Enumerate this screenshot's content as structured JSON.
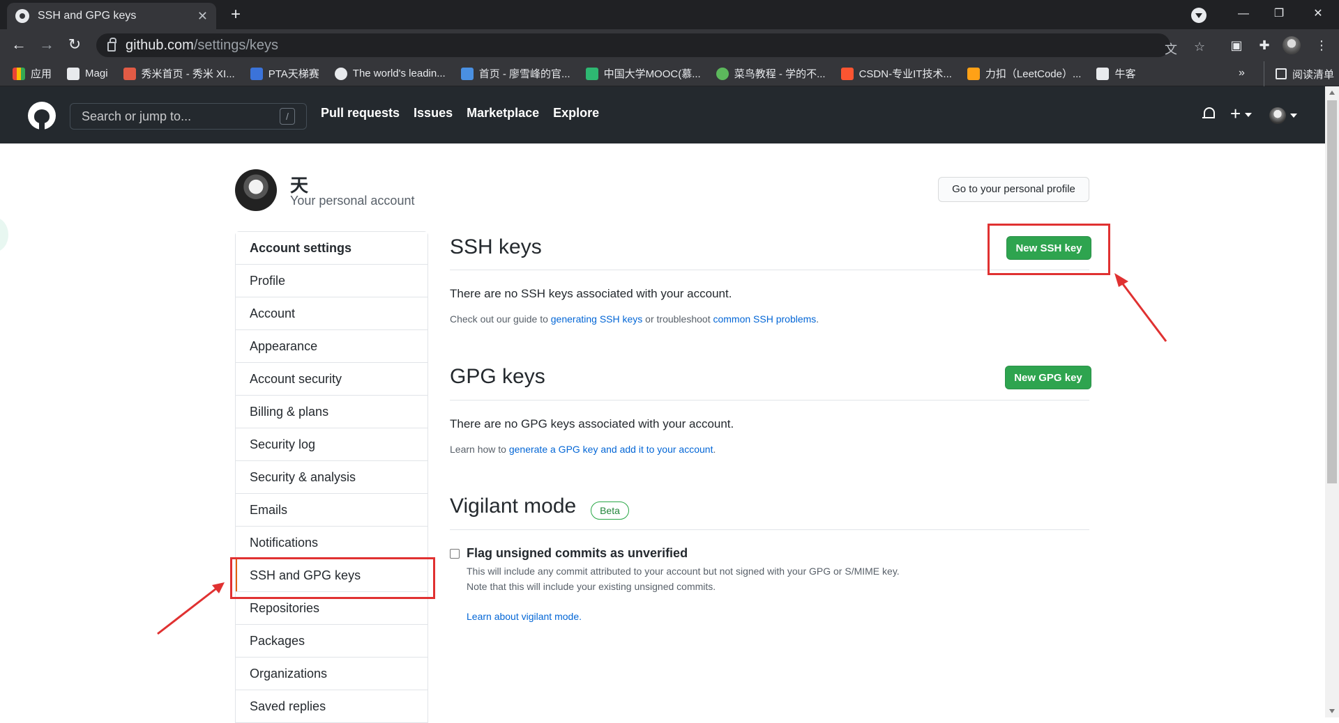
{
  "browser": {
    "tab_title": "SSH and GPG keys",
    "tab_close": "✕",
    "new_tab": "+",
    "url_host": "github.com",
    "url_path": "/settings/keys",
    "win_minimize": "—",
    "win_restore": "❐",
    "win_close": "✕",
    "bookmarks": [
      {
        "label": "应用",
        "icon_color": "#ea4335"
      },
      {
        "label": "Magi",
        "icon_color": "#e8eaed"
      },
      {
        "label": "秀米首页 - 秀米 XI...",
        "icon_color": "#e25b45"
      },
      {
        "label": "PTA天梯赛",
        "icon_color": "#3b73d9"
      },
      {
        "label": "The world's leadin...",
        "icon_color": "#e8eaed"
      },
      {
        "label": "首页 - 廖雪峰的官...",
        "icon_color": "#4a90e2"
      },
      {
        "label": "中国大学MOOC(慕...",
        "icon_color": "#2eb872"
      },
      {
        "label": "菜鸟教程 - 学的不...",
        "icon_color": "#5cb85c"
      },
      {
        "label": "CSDN-专业IT技术...",
        "icon_color": "#fc5531"
      },
      {
        "label": "力扣（LeetCode）...",
        "icon_color": "#ffa116"
      },
      {
        "label": "牛客",
        "icon_color": "#e8eaed"
      }
    ],
    "bookmarks_more": "»",
    "reading_list": "阅读清单"
  },
  "github": {
    "search_placeholder": "Search or jump to...",
    "search_shortcut": "/",
    "nav": [
      "Pull requests",
      "Issues",
      "Marketplace",
      "Explore"
    ],
    "plus": "+"
  },
  "profile": {
    "name": "天",
    "subtitle": "Your personal account",
    "profile_button": "Go to your personal profile"
  },
  "sidebar": {
    "header": "Account settings",
    "items": [
      {
        "label": "Profile"
      },
      {
        "label": "Account"
      },
      {
        "label": "Appearance"
      },
      {
        "label": "Account security"
      },
      {
        "label": "Billing & plans"
      },
      {
        "label": "Security log"
      },
      {
        "label": "Security & analysis"
      },
      {
        "label": "Emails"
      },
      {
        "label": "Notifications"
      },
      {
        "label": "SSH and GPG keys"
      },
      {
        "label": "Repositories"
      },
      {
        "label": "Packages"
      },
      {
        "label": "Organizations"
      },
      {
        "label": "Saved replies"
      }
    ]
  },
  "ssh": {
    "title": "SSH keys",
    "button": "New SSH key",
    "empty": "There are no SSH keys associated with your account.",
    "guide_prefix": "Check out our guide to ",
    "guide_link1": "generating SSH keys",
    "guide_mid": " or troubleshoot ",
    "guide_link2": "common SSH problems",
    "guide_suffix": "."
  },
  "gpg": {
    "title": "GPG keys",
    "button": "New GPG key",
    "empty": "There are no GPG keys associated with your account.",
    "learn_prefix": "Learn how to ",
    "learn_link": "generate a GPG key and add it to your account",
    "learn_suffix": "."
  },
  "vigilant": {
    "title": "Vigilant mode",
    "badge": "Beta",
    "checkbox_label": "Flag unsigned commits as unverified",
    "desc1": "This will include any commit attributed to your account but not signed with your GPG or S/MIME key.",
    "desc2": "Note that this will include your existing unsigned commits.",
    "learn_link": "Learn about vigilant mode."
  },
  "colors": {
    "accent_green": "#2ea44f",
    "link_blue": "#0366d6",
    "annotation_red": "#e03131",
    "header_dark": "#24292e"
  }
}
